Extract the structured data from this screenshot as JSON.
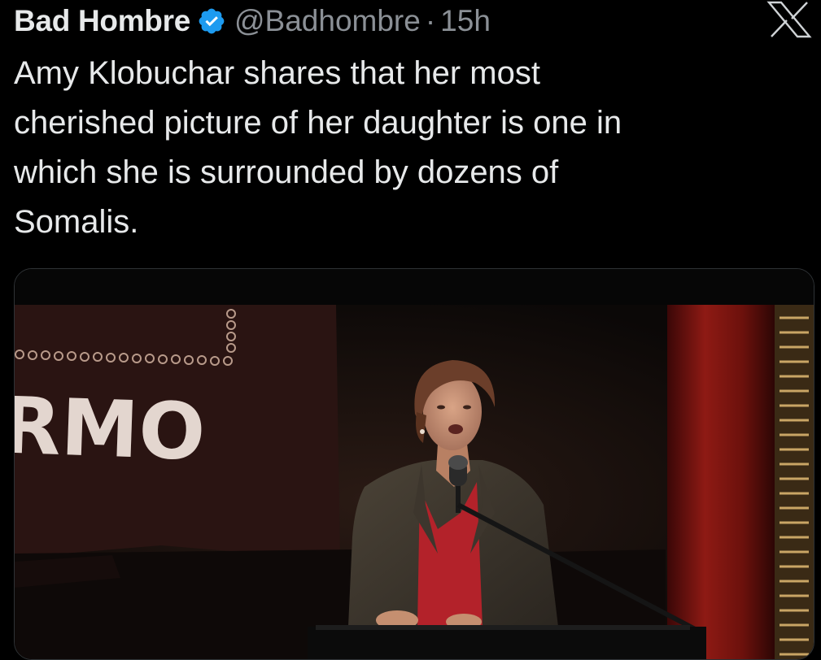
{
  "tweet": {
    "author_name": "Bad Hombre",
    "verified_icon": "verified-badge-icon",
    "handle": "@Badhombre",
    "separator": "·",
    "time": "15h",
    "platform_logo": "x-logo-icon",
    "text": "Amy Klobuchar shares that her most\ncherished picture of her daughter is one in\nwhich she is surrounded by dozens of\nSomalis.",
    "media": {
      "type": "photo",
      "sign_text": "RMO"
    }
  },
  "colors": {
    "background": "#000000",
    "text_primary": "#e7e9ea",
    "text_secondary": "#8b9096",
    "verified_blue": "#1d9bf0",
    "card_border": "#2f3336"
  }
}
